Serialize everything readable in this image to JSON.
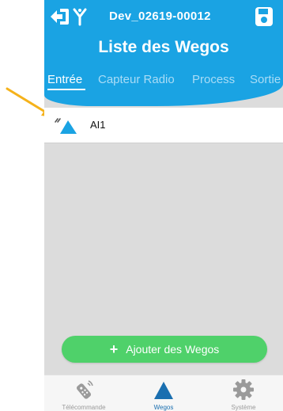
{
  "header": {
    "device_name": "Dev_02619-00012",
    "title": "Liste des Wegos"
  },
  "tabs": [
    {
      "label": "Entrée",
      "active": true
    },
    {
      "label": "Capteur Radio",
      "active": false
    },
    {
      "label": "Process",
      "active": false
    },
    {
      "label": "Sortie",
      "active": false
    }
  ],
  "list": {
    "items": [
      {
        "label": "AI1",
        "icon": "wego-triangle-icon"
      }
    ]
  },
  "add_button": {
    "label": "Ajouter des Wegos",
    "icon": "plus-icon"
  },
  "bottom_nav": [
    {
      "label": "Télécommande",
      "icon": "remote-control-icon",
      "active": false
    },
    {
      "label": "Wegos",
      "icon": "triangle-icon",
      "active": true
    },
    {
      "label": "Système",
      "icon": "gear-icon",
      "active": false
    }
  ],
  "colors": {
    "header_blue": "#1aa3e3",
    "add_button_green": "#4fd16a",
    "annotation_arrow": "#f5b21b",
    "content_gray": "#dcdcdc"
  }
}
